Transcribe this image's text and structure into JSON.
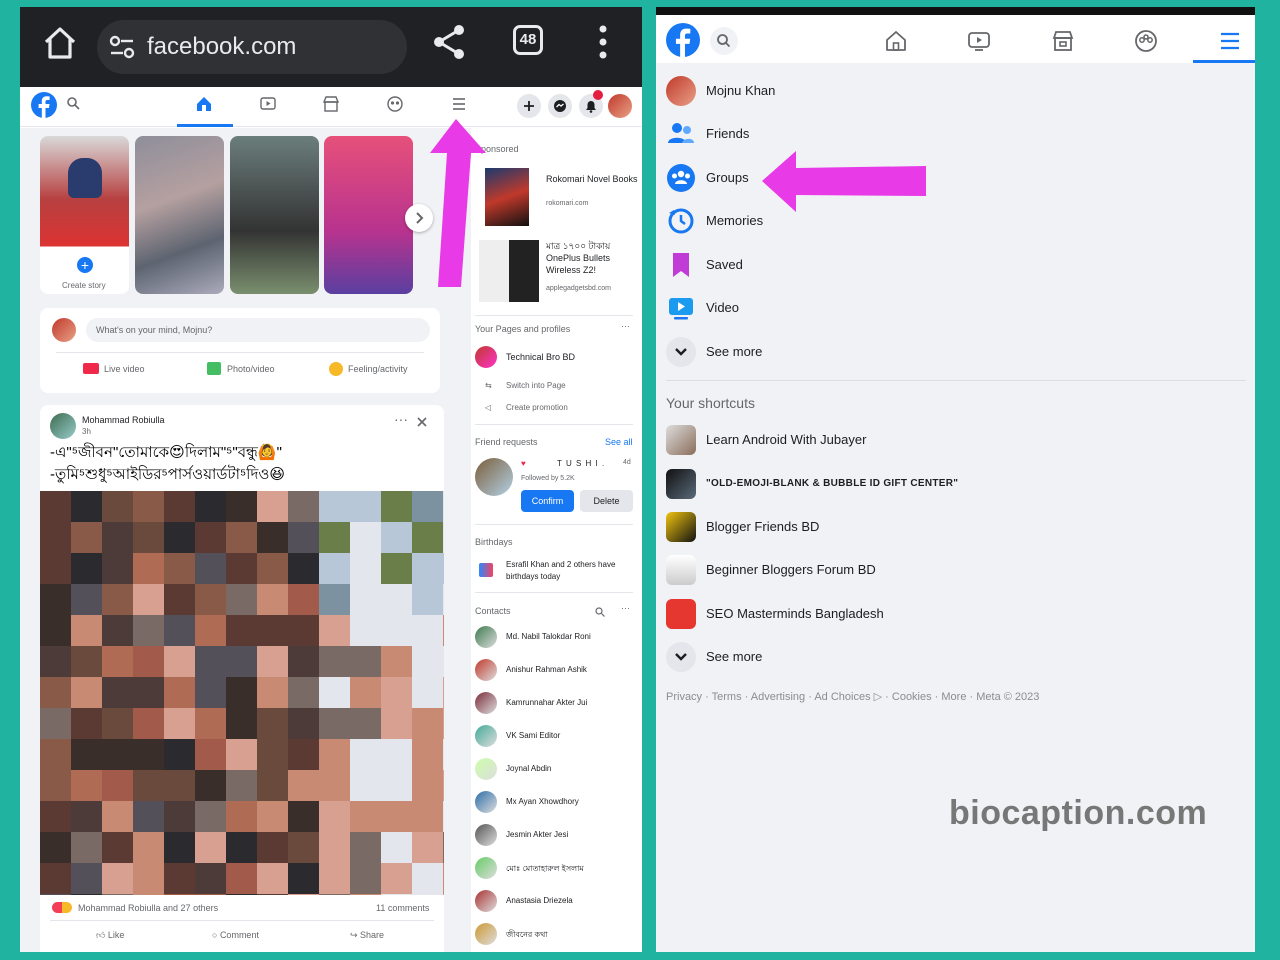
{
  "colors": {
    "accent": "#1877f2",
    "arrow": "#e83ae6",
    "frame": "#1fb3a0"
  },
  "left": {
    "browser": {
      "url": "facebook.com",
      "tab_count": "48"
    },
    "stories": {
      "create_label": "Create story"
    },
    "composer": {
      "placeholder": "What's on your mind, Mojnu?",
      "live": "Live video",
      "photo": "Photo/video",
      "feeling": "Feeling/activity"
    },
    "post": {
      "author": "Mohammad Robiulla",
      "time": "3h",
      "line1": "-এ\"⁵জীবন\"তোমাকে😍দিলাম\"⁵\"বন্ধু🙆\"",
      "line2": "-তুমি⁵শুধু⁵আইডির⁵পার্সওয়ার্ডটা⁵দিও😆",
      "reactions": "Mohammad Robiulla and 27 others",
      "comments": "11 comments",
      "like": "Like",
      "comment": "Comment",
      "share": "Share"
    },
    "sidebar": {
      "sponsored": "Sponsored",
      "ads": [
        {
          "title": "Rokomari Novel Books",
          "domain": "rokomari.com"
        },
        {
          "title": "মাত্র ১৭০০ টাকায় OnePlus Bullets Wireless Z2!",
          "domain": "applegadgetsbd.com"
        }
      ],
      "pages_title": "Your Pages and profiles",
      "page_name": "Technical Bro BD",
      "switch": "Switch into Page",
      "promo": "Create promotion",
      "fr_title": "Friend requests",
      "see_all": "See all",
      "fr_name": "T U S H I .",
      "fr_time": "4d",
      "fr_meta": "Followed by 5.2K",
      "confirm": "Confirm",
      "delete": "Delete",
      "bday_title": "Birthdays",
      "bday_text": "Esrafil Khan and 2 others have birthdays today",
      "contacts_title": "Contacts",
      "contacts": [
        "Md. Nabil Talokdar Roni",
        "Anishur Rahman Ashik",
        "Kamrunnahar Akter Jui",
        "VK Sami Editor",
        "Joynal Abdin",
        "Mx Ayan Xhowdhory",
        "Jesmin Akter Jesi",
        "মোঃ মোতাহারুল ইসলাম",
        "Anastasia Driezela",
        "জীবনের কথা"
      ]
    }
  },
  "right": {
    "menu": [
      {
        "label": "Mojnu Khan",
        "icon": "profile-avatar"
      },
      {
        "label": "Friends",
        "icon": "friends-icon"
      },
      {
        "label": "Groups",
        "icon": "groups-icon"
      },
      {
        "label": "Memories",
        "icon": "memories-icon"
      },
      {
        "label": "Saved",
        "icon": "saved-icon"
      },
      {
        "label": "Video",
        "icon": "video-icon"
      },
      {
        "label": "See more",
        "icon": "chevron-down-icon"
      }
    ],
    "shortcuts_title": "Your shortcuts",
    "shortcuts": [
      {
        "label": "Learn Android With Jubayer"
      },
      {
        "label": "\"OLD-EMOJI-BLANK & BUBBLE ID GIFT CENTER\""
      },
      {
        "label": "Blogger Friends BD"
      },
      {
        "label": "Beginner Bloggers Forum BD"
      },
      {
        "label": "SEO Masterminds Bangladesh"
      },
      {
        "label": "See more"
      }
    ],
    "footer": "Privacy · Terms · Advertising · Ad Choices ▷ · Cookies · More · Meta © 2023",
    "watermark": "biocaption.com"
  }
}
